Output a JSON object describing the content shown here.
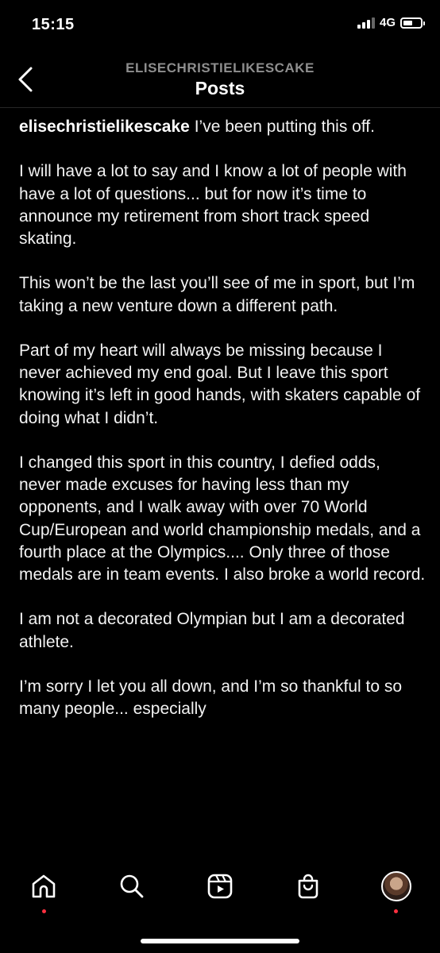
{
  "status": {
    "time": "15:15",
    "network": "4G"
  },
  "header": {
    "username": "ELISECHRISTIELIKESCAKE",
    "title": "Posts"
  },
  "post": {
    "author": "elisechristielikescake",
    "paragraphs": [
      "I’ve been putting this off.",
      "I will have a lot to say and I know a lot of people with have a lot of questions... but for now it’s time to announce my retirement from short track speed skating.",
      "This won’t be the last you’ll see of me in sport, but I’m taking a new venture down a different path.",
      "Part of my heart will always be missing because I never achieved my end goal. But I leave this sport knowing it’s left in good hands, with skaters capable of doing what I didn’t.",
      "I changed this sport in this country, I defied odds, never made excuses for having less than my opponents, and I walk away with over 70 World Cup/European and world championship medals, and a fourth place at the Olympics.... Only three of those medals are in team events. I also broke a world record.",
      "I am not a decorated Olympian but I am a decorated athlete.",
      "I’m sorry I let you all down, and I’m so thankful to so many people... especially"
    ]
  },
  "tabs": [
    {
      "icon": "home-icon",
      "badge": true
    },
    {
      "icon": "search-icon",
      "badge": false
    },
    {
      "icon": "reels-icon",
      "badge": false
    },
    {
      "icon": "shop-icon",
      "badge": false
    },
    {
      "icon": "profile-avatar",
      "badge": true
    }
  ],
  "colors": {
    "background": "#000000",
    "text": "#f5f5f5",
    "muted": "#8e8e8e",
    "badge": "#ff3040"
  }
}
